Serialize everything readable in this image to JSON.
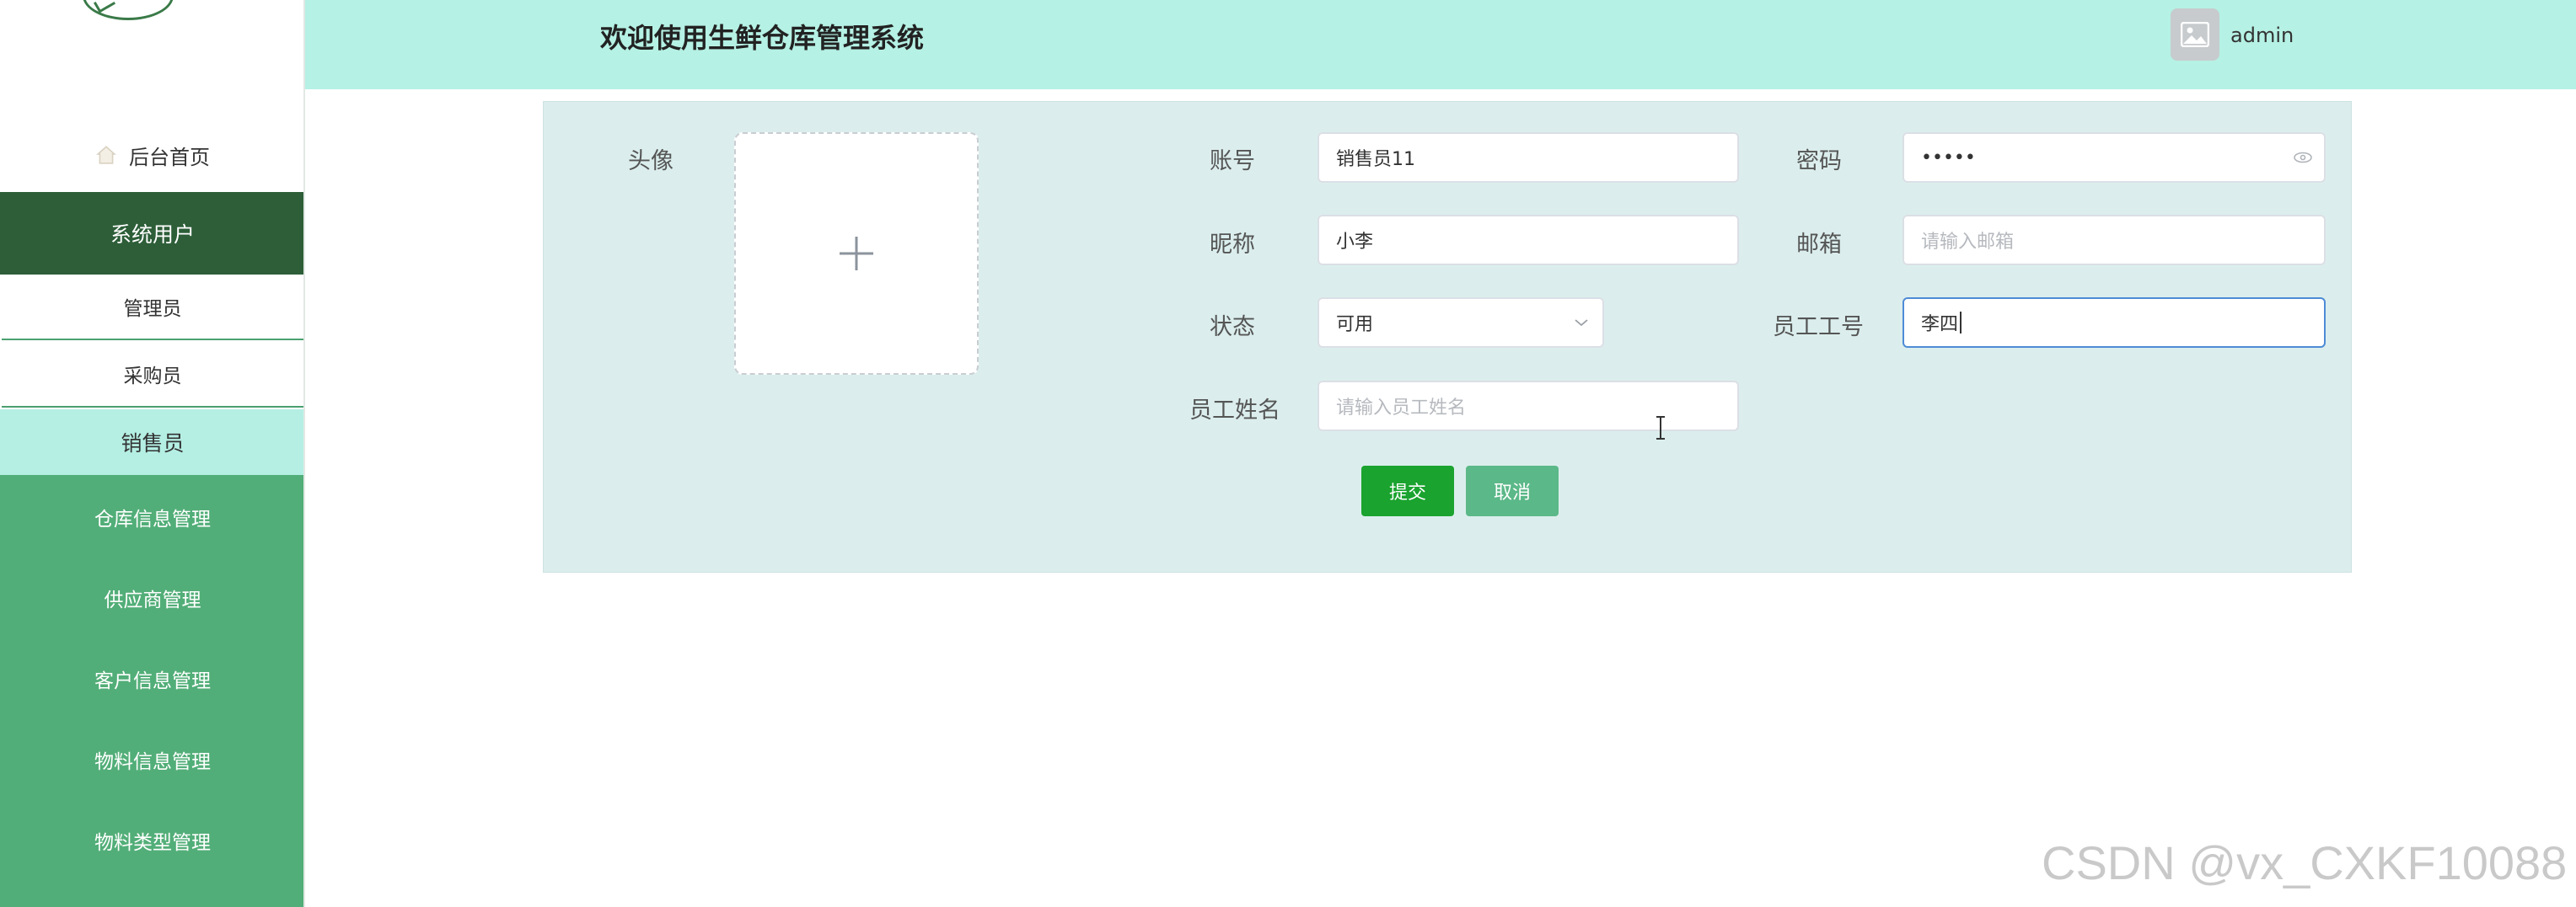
{
  "app": {
    "title": "欢迎使用生鲜仓库管理系统",
    "user": "admin"
  },
  "sidebar": {
    "home": "后台首页",
    "system_users": "系统用户",
    "sub_items": [
      "管理员",
      "采购员"
    ],
    "active_item": "销售员",
    "groups": [
      "仓库信息管理",
      "供应商管理",
      "客户信息管理",
      "物料信息管理",
      "物料类型管理"
    ]
  },
  "form": {
    "avatar_label": "头像",
    "account_label": "账号",
    "account_value": "销售员11",
    "password_label": "密码",
    "password_value": "•••••",
    "nickname_label": "昵称",
    "nickname_value": "小李",
    "email_label": "邮箱",
    "email_placeholder": "请输入邮箱",
    "status_label": "状态",
    "status_value": "可用",
    "employee_id_label": "员工工号",
    "employee_id_value": "李四",
    "employee_name_label": "员工姓名",
    "employee_name_placeholder": "请输入员工姓名",
    "submit": "提交",
    "cancel": "取消"
  },
  "watermark": "CSDN @vx_CXKF10088",
  "colors": {
    "header_bg": "#b5f1e4",
    "sidebar_dark": "#2d5e38",
    "sidebar_green": "#52ae78",
    "sidebar_active": "#b5efe4",
    "panel_bg": "#dbeeed",
    "submit": "#1aa32e",
    "cancel": "#5bb888"
  }
}
